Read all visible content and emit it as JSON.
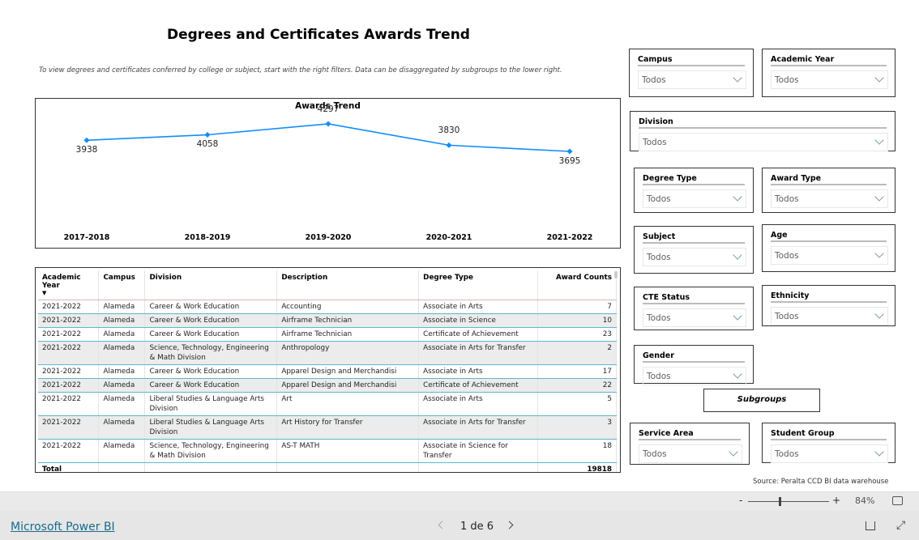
{
  "header": {
    "title": "Degrees and Certificates Awards Trend",
    "subtitle": "To view degrees and certificates conferred by college or subject, start with the right filters. Data can be disaggregated by subgroups to the lower right."
  },
  "chart_data": {
    "type": "line",
    "title": "Awards Trend",
    "categories": [
      "2017-2018",
      "2018-2019",
      "2019-2020",
      "2020-2021",
      "2021-2022"
    ],
    "values": [
      3938,
      4058,
      4297,
      3830,
      3695
    ],
    "labels": [
      "3938",
      "4058",
      "4297",
      "3830",
      "3695"
    ],
    "color": "#118dff",
    "grid": false
  },
  "table": {
    "headers": [
      "Academic Year",
      "Campus",
      "Division",
      "Description",
      "Degree Type",
      "Award Counts"
    ],
    "rows": [
      [
        "2021-2022",
        "Alameda",
        "Career & Work Education",
        "Accounting",
        "Associate in Arts",
        "7"
      ],
      [
        "2021-2022",
        "Alameda",
        "Career & Work Education",
        "Airframe Technician",
        "Associate in Science",
        "10"
      ],
      [
        "2021-2022",
        "Alameda",
        "Career & Work Education",
        "Airframe Technician",
        "Certificate of Achievement",
        "23"
      ],
      [
        "2021-2022",
        "Alameda",
        "Science, Technology, Engineering & Math Division",
        "Anthropology",
        "Associate in Arts for Transfer",
        "2"
      ],
      [
        "2021-2022",
        "Alameda",
        "Career & Work Education",
        "Apparel Design and Merchandisi",
        "Associate in Arts",
        "17"
      ],
      [
        "2021-2022",
        "Alameda",
        "Career & Work Education",
        "Apparel Design and Merchandisi",
        "Certificate of Achievement",
        "22"
      ],
      [
        "2021-2022",
        "Alameda",
        "Liberal Studies & Language Arts Division",
        "Art",
        "Associate in Arts",
        "5"
      ],
      [
        "2021-2022",
        "Alameda",
        "Liberal Studies & Language Arts Division",
        "Art History for Transfer",
        "Associate in Arts for Transfer",
        "3"
      ],
      [
        "2021-2022",
        "Alameda",
        "Science, Technology, Engineering & Math Division",
        "AS-T MATH",
        "Associate in Science for Transfer",
        "18"
      ]
    ],
    "total_label": "Total",
    "total_value": "19818"
  },
  "slicers": [
    {
      "label": "Campus",
      "value": "Todos"
    },
    {
      "label": "Academic Year",
      "value": "Todos"
    },
    {
      "label": "Division",
      "value": "Todos"
    },
    {
      "label": "Degree Type",
      "value": "Todos"
    },
    {
      "label": "Award Type",
      "value": "Todos"
    },
    {
      "label": "Subject",
      "value": "Todos"
    },
    {
      "label": "Age",
      "value": "Todos"
    },
    {
      "label": "CTE Status",
      "value": "Todos"
    },
    {
      "label": "Ethnicity",
      "value": "Todos"
    },
    {
      "label": "Gender",
      "value": "Todos"
    },
    {
      "label": "Service Area",
      "value": "Todos"
    },
    {
      "label": "Student Group",
      "value": "Todos"
    }
  ],
  "subgroups_label": "Subgroups",
  "source": "Source: Peralta CCD BI data warehouse",
  "zoom": {
    "minus": "-",
    "plus": "+",
    "level": "84%"
  },
  "footer": {
    "brand": "Microsoft Power BI",
    "page": "1 de 6"
  }
}
